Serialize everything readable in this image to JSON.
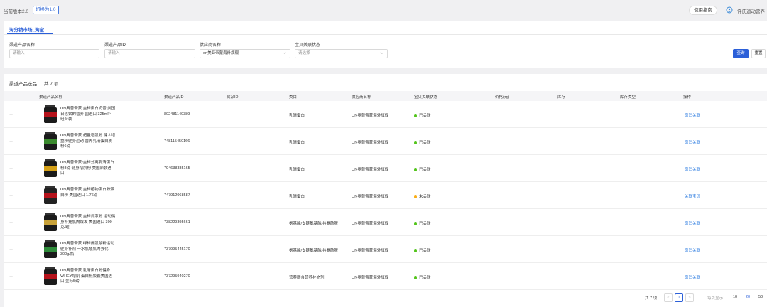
{
  "topbar": {
    "version_label": "当前版本2.0",
    "switch_label": "切换为1.0",
    "guide_label": "使用指南",
    "user_name": "许氏运动营养"
  },
  "tab": {
    "label": "淘分销市场_淘宝"
  },
  "filters": {
    "product_name": {
      "label": "渠道产品名称",
      "placeholder": "请输入"
    },
    "product_id": {
      "label": "渠道产品ID",
      "placeholder": "请输入"
    },
    "supplier": {
      "label": "供应商名称",
      "value": "on美亚帝蒙海外旗舰"
    },
    "link_status": {
      "label": "宝贝关联状态",
      "placeholder": "请选择"
    },
    "search_label": "查询",
    "reset_label": "重置"
  },
  "list": {
    "title": "渠道产品选品",
    "count": "共 7 项",
    "columns": [
      "渠道产品名称",
      "渠道产品ID",
      "货品ID",
      "类目",
      "供应商名称",
      "宝贝关联状态",
      "价格(元)",
      "库存",
      "库存类型",
      "操作"
    ],
    "rows": [
      {
        "name": "ON奥普帝蒙 金标蛋白奶昔 美国日落饮的营养 国进口 325ml*4组合装",
        "id": "802481149389",
        "goods_id": "--",
        "category": "乳清蛋白",
        "supplier": "ON奥普帝蒙海外旗舰",
        "status": "已关联",
        "status_color": "#52c41a",
        "price": "",
        "stock": "",
        "stock_type": "--",
        "action": "取消关联"
      },
      {
        "name": "ON奥普帝蒙 超量增肌粉 健人增重粉健身运动 营养乳清蛋白质粉6磅",
        "id": "748115450166",
        "goods_id": "--",
        "category": "乳清蛋白",
        "supplier": "ON奥普帝蒙海外旗舰",
        "status": "已关联",
        "status_color": "#52c41a",
        "price": "",
        "stock": "",
        "stock_type": "--",
        "action": "取消关联"
      },
      {
        "name": "ON奥普帝蒙/金标分离乳清蛋白粉3磅 健身增肌粉 美国原装进口,",
        "id": "794638385165",
        "goods_id": "--",
        "category": "乳清蛋白",
        "supplier": "ON奥普帝蒙海外旗舰",
        "status": "已关联",
        "status_color": "#52c41a",
        "price": "",
        "stock": "",
        "stock_type": "--",
        "action": "取消关联"
      },
      {
        "name": "ON奥普帝蒙 金标植物蛋白粉蛋白粉 美国进口 1.76磅",
        "id": "747912068587",
        "goods_id": "--",
        "category": "乳清蛋白",
        "supplier": "ON奥普帝蒙海外旗舰",
        "status": "未关联",
        "status_color": "#faad14",
        "price": "",
        "stock": "",
        "stock_type": "--",
        "action": "关联宝贝"
      },
      {
        "name": "ON奥普帝蒙 金标氮泵粉 运动健身补充肌肉爆发 美国进口 300克/罐",
        "id": "738229395661",
        "goods_id": "--",
        "category": "氨基酸/支链氨基酸/谷氨酰胺",
        "supplier": "ON奥普帝蒙海外旗舰",
        "status": "已关联",
        "status_color": "#52c41a",
        "price": "",
        "stock": "",
        "stock_type": "--",
        "action": "取消关联"
      },
      {
        "name": "ON奥普帝蒙 绿标氨肌酸粉运动健身补剂 一水肌酸肌肉强化 300g/瓶",
        "id": "737995445170",
        "goods_id": "--",
        "category": "氨基酸/支链氨基酸/谷氨酰胺",
        "supplier": "ON奥普帝蒙海外旗舰",
        "status": "已关联",
        "status_color": "#52c41a",
        "price": "",
        "stock": "",
        "stock_type": "--",
        "action": "取消关联"
      },
      {
        "name": "ON奥普帝蒙 乳清蛋白粉健身WHEY增肌 蛋白粉胶囊美国进口 金标5磅",
        "id": "737295940270",
        "goods_id": "--",
        "category": "营养膳食营养补充剂",
        "supplier": "ON奥普帝蒙海外旗舰",
        "status": "已关联",
        "status_color": "#52c41a",
        "price": "",
        "stock": "",
        "stock_type": "--",
        "action": "取消关联"
      }
    ]
  },
  "pager": {
    "total": "共 7 项",
    "prev": "<",
    "page": "1",
    "next": ">",
    "size_label": "每页显示：",
    "sizes": [
      "10",
      "20",
      "50"
    ],
    "active_size": "20"
  }
}
